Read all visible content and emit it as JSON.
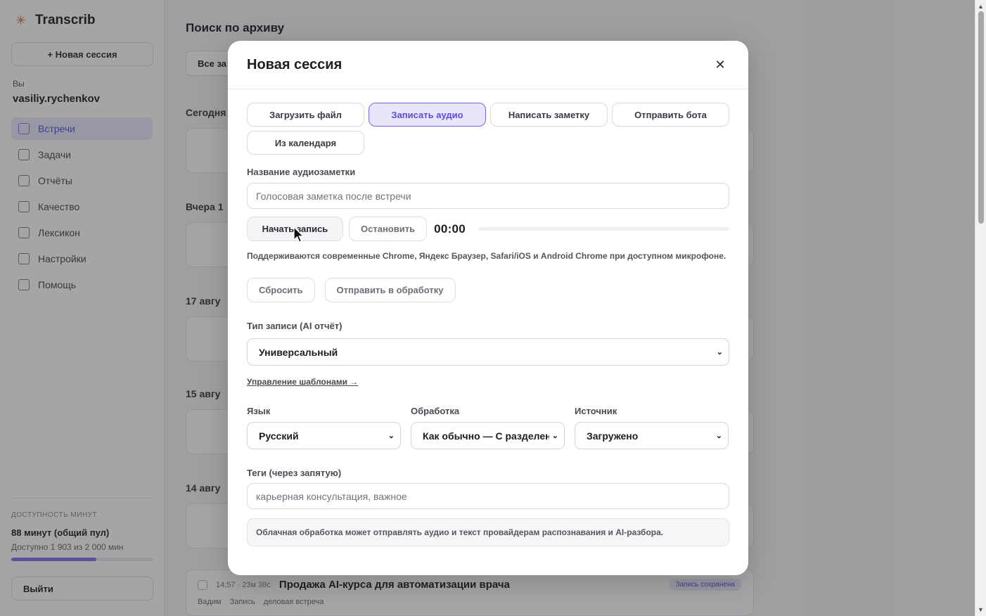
{
  "sidebar": {
    "brand": "Transcrib",
    "new_session": "+ Новая сессия",
    "user_caption": "Вы",
    "user_name": "vasiliy.rychenkov",
    "nav": [
      {
        "label": "Встречи",
        "icon": "calendar-icon"
      },
      {
        "label": "Задачи",
        "icon": "checklist-icon"
      },
      {
        "label": "Отчёты",
        "icon": "chart-icon"
      },
      {
        "label": "Качество",
        "icon": "check-icon"
      },
      {
        "label": "Лексикон",
        "icon": "book-icon"
      },
      {
        "label": "Настройки",
        "icon": "gear-icon"
      },
      {
        "label": "Помощь",
        "icon": "help-icon"
      }
    ],
    "usage_caption": "Доступность минут",
    "usage_title": "88 минут (общий пул)",
    "usage_sub": "Доступно 1 903 из 2 000 мин",
    "usage_fraction": 0.6,
    "logout": "Выйти"
  },
  "main": {
    "archive_title": "Поиск по архиву",
    "filter_label": "Все за",
    "days": [
      "Сегодня",
      "Вчера 1",
      "17 авгу",
      "15 авгу",
      "14 авгу"
    ],
    "last_row": {
      "time": "14:57 · 23м 38с",
      "title": "Продажа AI-курса для автоматизации врача",
      "badge": "Запись сохранена",
      "author": "Вадим",
      "status": "Запись",
      "tag": "деловая встреча"
    }
  },
  "modal": {
    "title": "Новая сессия",
    "tabs": [
      {
        "label": "Загрузить файл",
        "active": false
      },
      {
        "label": "Записать аудио",
        "active": true
      },
      {
        "label": "Написать заметку",
        "active": false
      },
      {
        "label": "Отправить бота",
        "active": false
      },
      {
        "label": "Из календаря",
        "active": false
      }
    ],
    "note_name_label": "Название аудиозаметки",
    "note_name_placeholder": "Голосовая заметка после встречи",
    "start_button": "Начать запись",
    "stop_button": "Остановить",
    "timer": "00:00",
    "hint": "Поддерживаются современные Chrome, Яндекс Браузер, Safari/iOS и Android Chrome при доступном микрофоне.",
    "reset_button": "Сбросить",
    "submit_button": "Отправить в обработку",
    "record_type_label": "Тип записи (AI отчёт)",
    "record_type_value": "Универсальный",
    "templates_link": "Управление шаблонами →",
    "language_label": "Язык",
    "language_value": "Русский",
    "processing_label": "Обработка",
    "processing_value": "Как обычно — С разделением",
    "source_label": "Источник",
    "source_value": "Загружено",
    "tags_label": "Теги (через запятую)",
    "tags_placeholder": "карьерная консультация, важное",
    "notice": "Облачная обработка может отправлять аудио и текст провайдерам распознавания и AI-разбора."
  },
  "colors": {
    "accent": "#7367e8",
    "accent_bg": "#e8e6fb",
    "overlay": "rgba(40,40,44,0.42)"
  }
}
